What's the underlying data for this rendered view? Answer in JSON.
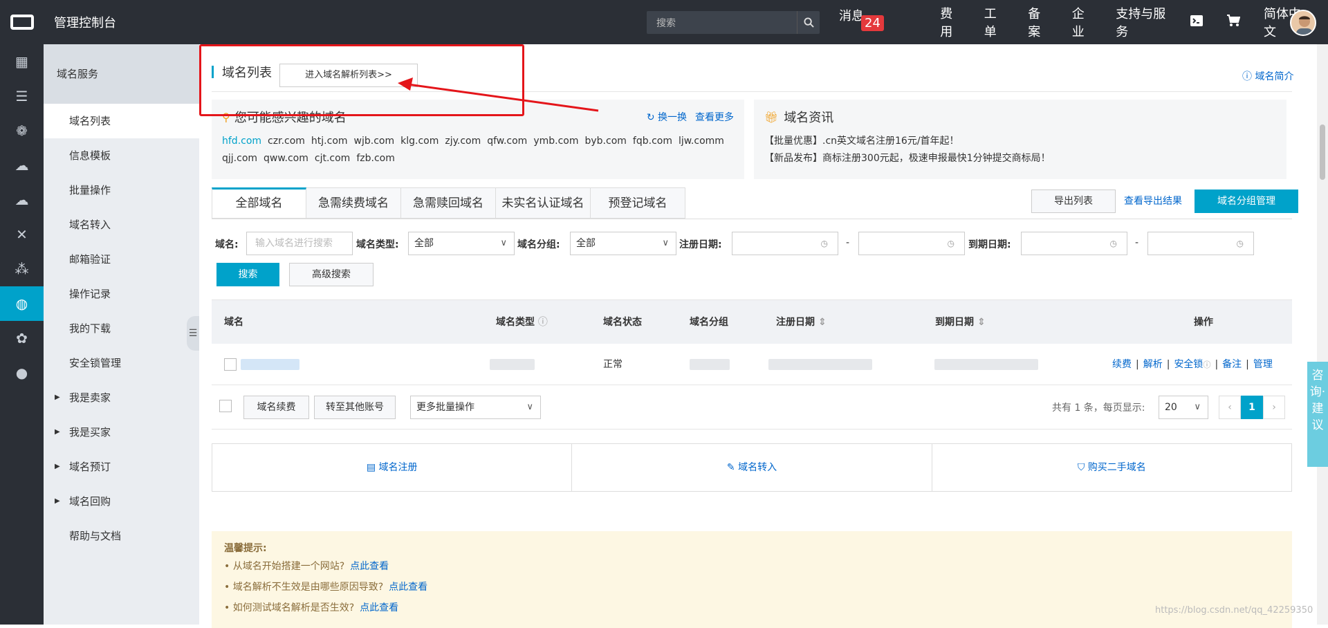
{
  "topbar": {
    "console_title": "管理控制台",
    "search_placeholder": "搜索",
    "nav": {
      "messages": "消息",
      "messages_count": "24",
      "fees": "费用",
      "tickets": "工单",
      "filing": "备案",
      "enterprise": "企业",
      "support": "支持与服务",
      "language": "简体中文"
    }
  },
  "sidebar": {
    "header": "域名服务",
    "items": [
      {
        "label": "域名列表"
      },
      {
        "label": "信息模板"
      },
      {
        "label": "批量操作"
      },
      {
        "label": "域名转入"
      },
      {
        "label": "邮箱验证"
      },
      {
        "label": "操作记录"
      },
      {
        "label": "我的下载"
      },
      {
        "label": "安全锁管理"
      },
      {
        "label": "我是卖家"
      },
      {
        "label": "我是买家"
      },
      {
        "label": "域名预订"
      },
      {
        "label": "域名回购"
      },
      {
        "label": "帮助与文档"
      }
    ]
  },
  "page": {
    "title": "域名列表",
    "enter_dns_button": "进入域名解析列表>>",
    "intro_link": "域名简介"
  },
  "interest": {
    "title": "您可能感兴趣的域名",
    "refresh": "换一换",
    "more": "查看更多",
    "domains_row1": [
      "hfd.com",
      "czr.com",
      "htj.com",
      "wjb.com",
      "klg.com",
      "zjy.com",
      "qfw.com",
      "ymb.com",
      "byb.com",
      "fqb.com",
      "ljw.comm"
    ],
    "domains_row2": [
      "qjj.com",
      "qww.com",
      "cjt.com",
      "fzb.com"
    ]
  },
  "news": {
    "title": "域名资讯",
    "items": [
      "【批量优惠】.cn英文域名注册16元/首年起！",
      "【新品发布】商标注册300元起，极速申报最快1分钟提交商标局！"
    ]
  },
  "tabs": [
    "全部域名",
    "急需续费域名",
    "急需赎回域名",
    "未实名认证域名",
    "预登记域名"
  ],
  "toolbar": {
    "export_list": "导出列表",
    "view_export": "查看导出结果",
    "group_manage": "域名分组管理"
  },
  "filters": {
    "domain_label": "域名:",
    "domain_placeholder": "输入域名进行搜索",
    "type_label": "域名类型:",
    "type_value": "全部",
    "group_label": "域名分组:",
    "group_value": "全部",
    "reg_date_label": "注册日期:",
    "exp_date_label": "到期日期:",
    "dash": "-",
    "search_button": "搜索",
    "advanced_button": "高级搜索"
  },
  "table": {
    "columns": [
      "域名",
      "域名类型",
      "域名状态",
      "域名分组",
      "注册日期",
      "到期日期",
      "操作"
    ],
    "rows": [
      {
        "status": "正常",
        "ops": [
          "续费",
          "解析",
          "安全锁",
          "备注",
          "管理"
        ]
      }
    ]
  },
  "footer": {
    "renew_button": "域名续费",
    "transfer_button": "转至其他账号",
    "batch_select": "更多批量操作",
    "total_text": "共有 1 条，每页显示:",
    "page_size": "20",
    "current_page": "1",
    "prev": "‹",
    "next": "›"
  },
  "quick_links": [
    "域名注册",
    "域名转入",
    "购买二手域名"
  ],
  "tips": {
    "title": "温馨提示:",
    "items": [
      {
        "text": "• 从域名开始搭建一个网站?",
        "link": "点此查看"
      },
      {
        "text": "• 域名解析不生效是由哪些原因导致?",
        "link": "点此查看"
      },
      {
        "text": "• 如何测试域名解析是否生效?",
        "link": "点此查看"
      }
    ]
  },
  "advice_tab": "咨询·建议",
  "watermark": "https://blog.csdn.net/qq_42259350"
}
